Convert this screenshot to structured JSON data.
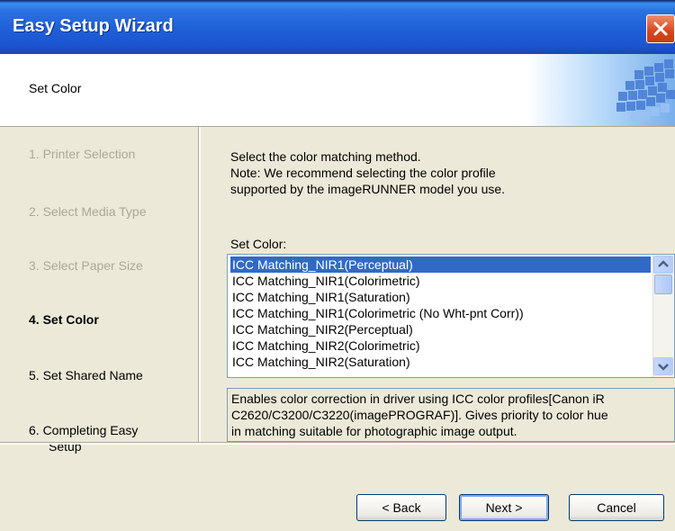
{
  "window": {
    "title": "Easy Setup Wizard"
  },
  "header": {
    "title": "Set Color"
  },
  "steps": [
    {
      "label": "1.  Printer Selection",
      "state": "done"
    },
    {
      "label": "2.  Select Media Type",
      "state": "done"
    },
    {
      "label": "3.  Select Paper Size",
      "state": "done"
    },
    {
      "label": "4.  Set Color",
      "state": "current"
    },
    {
      "label": "5.  Set Shared Name",
      "state": "pending"
    },
    {
      "label": "6.  Completing Easy",
      "label2": "Setup",
      "state": "pending"
    }
  ],
  "content": {
    "intro_line1": "Select the color matching method.",
    "intro_line2": "Note: We recommend selecting the color profile",
    "intro_line3": "supported by the imageRUNNER model you use.",
    "list_label": "Set Color:",
    "list_items": [
      "ICC Matching_NIR1(Perceptual)",
      "ICC Matching_NIR1(Colorimetric)",
      "ICC Matching_NIR1(Saturation)",
      "ICC Matching_NIR1(Colorimetric (No Wht-pnt Corr))",
      "ICC Matching_NIR2(Perceptual)",
      "ICC Matching_NIR2(Colorimetric)",
      "ICC Matching_NIR2(Saturation)"
    ],
    "selected_index": 0,
    "description_line1": "Enables color correction in driver using ICC color profiles[Canon iR",
    "description_line2": "C2620/C3200/C3220(imagePROGRAF)]. Gives priority to color hue",
    "description_line3": "in matching suitable for photographic image output."
  },
  "buttons": {
    "back": "< Back",
    "next": "Next >",
    "cancel": "Cancel"
  },
  "colors": {
    "titlebar": "#1f5fd8",
    "selection": "#316ac5",
    "background": "#ece9d8"
  }
}
